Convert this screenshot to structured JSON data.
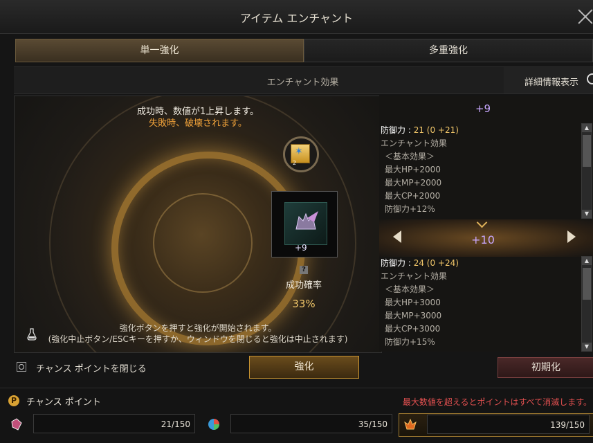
{
  "window": {
    "title": "アイテム エンチャント"
  },
  "tabs": [
    {
      "label": "単一強化"
    },
    {
      "label": "多重強化"
    }
  ],
  "enchant_effect_header": "エンチャント効果",
  "detail_button": "詳細情報表示",
  "messages": {
    "success": "成功時、数値が1上昇します。",
    "failure": "失敗時、破壊されます。"
  },
  "scroll_count": "2",
  "item": {
    "enchant_level": "+9"
  },
  "success_rate": {
    "label": "成功確率",
    "value": "33%"
  },
  "info_lines": [
    "強化ボタンを押すと強化が開始されます。",
    "(強化中止ボタン/ESCキーを押すか、ウィンドウを閉じると強化は中止されます)"
  ],
  "current": {
    "level": "+9",
    "defense_label": "防御力 :",
    "defense_value": "21 (0 +21)",
    "effect_title": "エンチャント効果",
    "basic": "＜基本効果＞",
    "lines": [
      "最大HP+2000",
      "最大MP+2000",
      "最大CP+2000",
      "防御力+12%"
    ]
  },
  "next": {
    "level": "+10",
    "defense_label": "防御力 :",
    "defense_value": "24 (0 +24)",
    "effect_title": "エンチャント効果",
    "basic": "＜基本効果＞",
    "lines": [
      "最大HP+3000",
      "最大MP+3000",
      "最大CP+3000",
      "防御力+15%"
    ]
  },
  "close_chance_label": "チャンス ポイントを閉じる",
  "enchant_button": "強化",
  "reset_button": "初期化",
  "chance": {
    "icon": "P",
    "title": "チャンス ポイント",
    "warning": "最大数値を超えるとポイントはすべて消滅します。",
    "slots": [
      {
        "value": "21/150"
      },
      {
        "value": "35/150"
      },
      {
        "value": "139/150"
      }
    ]
  }
}
